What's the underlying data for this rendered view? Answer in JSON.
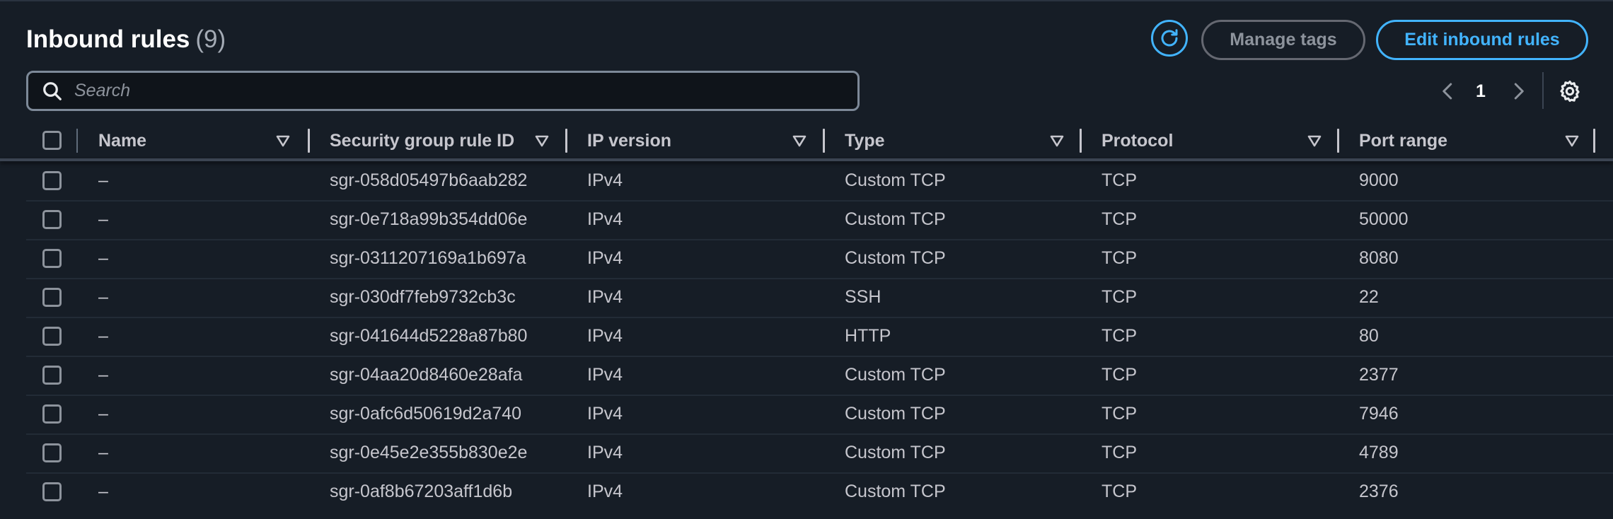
{
  "header": {
    "title": "Inbound rules",
    "count": "(9)",
    "manage_tags_label": "Manage tags",
    "edit_rules_label": "Edit inbound rules"
  },
  "search": {
    "placeholder": "Search",
    "value": ""
  },
  "pagination": {
    "current_page": "1"
  },
  "colors": {
    "accent": "#42b4ff",
    "background": "#161d26",
    "text": "#c6c6cd",
    "title": "#ffffff"
  },
  "icons": {
    "refresh": "refresh-icon",
    "search": "search-icon",
    "prev": "chevron-left-icon",
    "next": "chevron-right-icon",
    "settings": "gear-icon",
    "sort": "sort-down-triangle-icon"
  },
  "table": {
    "columns": [
      {
        "key": "name",
        "label": "Name"
      },
      {
        "key": "rule_id",
        "label": "Security group rule ID"
      },
      {
        "key": "ip_version",
        "label": "IP version"
      },
      {
        "key": "type",
        "label": "Type"
      },
      {
        "key": "protocol",
        "label": "Protocol"
      },
      {
        "key": "port_range",
        "label": "Port range"
      }
    ],
    "rows": [
      {
        "name": "–",
        "rule_id": "sgr-058d05497b6aab282",
        "ip_version": "IPv4",
        "type": "Custom TCP",
        "protocol": "TCP",
        "port_range": "9000"
      },
      {
        "name": "–",
        "rule_id": "sgr-0e718a99b354dd06e",
        "ip_version": "IPv4",
        "type": "Custom TCP",
        "protocol": "TCP",
        "port_range": "50000"
      },
      {
        "name": "–",
        "rule_id": "sgr-0311207169a1b697a",
        "ip_version": "IPv4",
        "type": "Custom TCP",
        "protocol": "TCP",
        "port_range": "8080"
      },
      {
        "name": "–",
        "rule_id": "sgr-030df7feb9732cb3c",
        "ip_version": "IPv4",
        "type": "SSH",
        "protocol": "TCP",
        "port_range": "22"
      },
      {
        "name": "–",
        "rule_id": "sgr-041644d5228a87b80",
        "ip_version": "IPv4",
        "type": "HTTP",
        "protocol": "TCP",
        "port_range": "80"
      },
      {
        "name": "–",
        "rule_id": "sgr-04aa20d8460e28afa",
        "ip_version": "IPv4",
        "type": "Custom TCP",
        "protocol": "TCP",
        "port_range": "2377"
      },
      {
        "name": "–",
        "rule_id": "sgr-0afc6d50619d2a740",
        "ip_version": "IPv4",
        "type": "Custom TCP",
        "protocol": "TCP",
        "port_range": "7946"
      },
      {
        "name": "–",
        "rule_id": "sgr-0e45e2e355b830e2e",
        "ip_version": "IPv4",
        "type": "Custom TCP",
        "protocol": "TCP",
        "port_range": "4789"
      },
      {
        "name": "–",
        "rule_id": "sgr-0af8b67203aff1d6b",
        "ip_version": "IPv4",
        "type": "Custom TCP",
        "protocol": "TCP",
        "port_range": "2376"
      }
    ]
  }
}
